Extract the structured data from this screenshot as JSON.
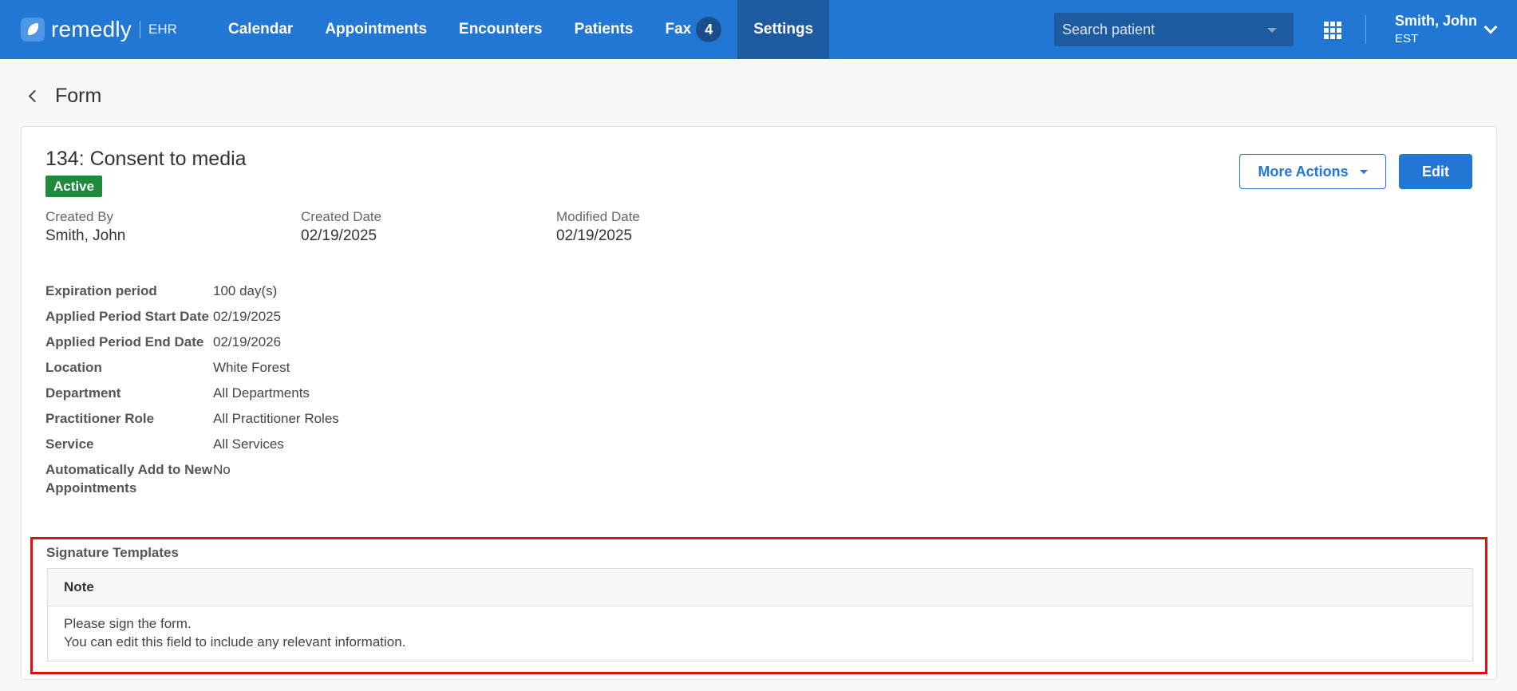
{
  "app": {
    "brand": "remedly",
    "product": "EHR"
  },
  "nav": [
    {
      "label": "Calendar"
    },
    {
      "label": "Appointments"
    },
    {
      "label": "Encounters"
    },
    {
      "label": "Patients"
    },
    {
      "label": "Fax",
      "badge": "4"
    },
    {
      "label": "Settings",
      "active": true
    }
  ],
  "search": {
    "placeholder": "Search patient"
  },
  "user": {
    "name": "Smith, John",
    "timezone": "EST"
  },
  "page": {
    "title": "Form"
  },
  "form": {
    "title": "134: Consent to media",
    "status": "Active",
    "more_actions_label": "More Actions",
    "edit_label": "Edit",
    "meta": {
      "created_by_label": "Created By",
      "created_by": "Smith, John",
      "created_date_label": "Created Date",
      "created_date": "02/19/2025",
      "modified_date_label": "Modified Date",
      "modified_date": "02/19/2025"
    },
    "details": [
      {
        "label": "Expiration period",
        "value": "100 day(s)"
      },
      {
        "label": "Applied Period Start Date",
        "value": "02/19/2025"
      },
      {
        "label": "Applied Period End Date",
        "value": "02/19/2026"
      },
      {
        "label": "Location",
        "value": "White Forest"
      },
      {
        "label": "Department",
        "value": "All Departments"
      },
      {
        "label": "Practitioner Role",
        "value": "All Practitioner Roles"
      },
      {
        "label": "Service",
        "value": "All Services"
      },
      {
        "label": "Automatically Add to New Appointments",
        "value": "No"
      }
    ],
    "signature": {
      "title": "Signature Templates",
      "column": "Note",
      "lines": [
        "Please sign the form.",
        "You can edit this field to include any relevant information."
      ]
    }
  },
  "colors": {
    "primary": "#2277d5",
    "nav_active": "#1e5aa0",
    "status_active": "#1f8a3b",
    "highlight": "#e01010"
  },
  "icons": [
    "logo-icon",
    "chevron-down-icon",
    "apps-grid-icon",
    "back-chevron-icon",
    "caret-down-icon"
  ]
}
